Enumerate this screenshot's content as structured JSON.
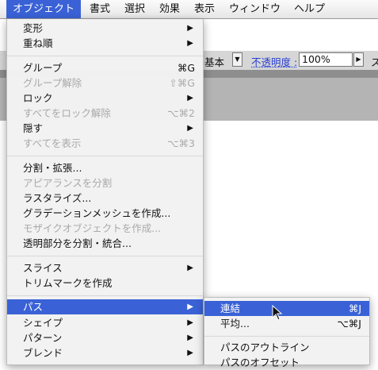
{
  "menubar": {
    "items": [
      "オブジェクト",
      "書式",
      "選択",
      "効果",
      "表示",
      "ウィンドウ",
      "ヘルプ"
    ],
    "active_index": 0
  },
  "toolbar": {
    "stroke_style": "基本",
    "opacity_label": "不透明度 :",
    "opacity_value": "100%",
    "trailing_text": "ス"
  },
  "object_menu": {
    "items": [
      {
        "label": "変形",
        "submenu": true
      },
      {
        "label": "重ね順",
        "submenu": true
      },
      {
        "label": "グループ",
        "shortcut": "⌘G"
      },
      {
        "label": "グループ解除",
        "shortcut": "⇧⌘G",
        "disabled": true
      },
      {
        "label": "ロック",
        "submenu": true
      },
      {
        "label": "すべてをロック解除",
        "shortcut": "⌥⌘2",
        "disabled": true
      },
      {
        "label": "隠す",
        "submenu": true
      },
      {
        "label": "すべてを表示",
        "shortcut": "⌥⌘3",
        "disabled": true
      },
      {
        "label": "分割・拡張..."
      },
      {
        "label": "アピアランスを分割",
        "disabled": true
      },
      {
        "label": "ラスタライズ..."
      },
      {
        "label": "グラデーションメッシュを作成..."
      },
      {
        "label": "モザイクオブジェクトを作成...",
        "disabled": true
      },
      {
        "label": "透明部分を分割・統合..."
      },
      {
        "label": "スライス",
        "submenu": true
      },
      {
        "label": "トリムマークを作成"
      },
      {
        "label": "パス",
        "submenu": true,
        "highlighted": true
      },
      {
        "label": "シェイプ",
        "submenu": true
      },
      {
        "label": "パターン",
        "submenu": true
      },
      {
        "label": "ブレンド",
        "submenu": true
      }
    ]
  },
  "path_submenu": {
    "items": [
      {
        "label": "連結",
        "shortcut": "⌘J",
        "highlighted": true
      },
      {
        "label": "平均...",
        "shortcut": "⌥⌘J"
      },
      {
        "label": "パスのアウトライン"
      },
      {
        "label": "パスのオフセット"
      }
    ]
  },
  "icons": {
    "submenu_arrow": "▶",
    "dropdown_arrow": "▼",
    "cursor": "arrow-pointer-icon"
  }
}
